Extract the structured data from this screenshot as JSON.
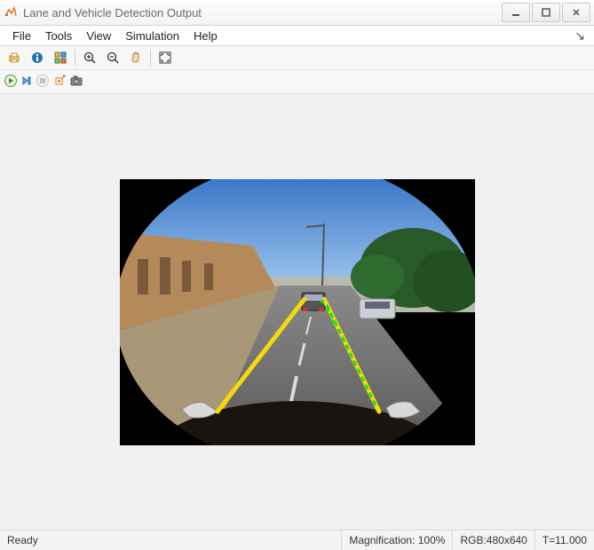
{
  "window": {
    "title": "Lane and Vehicle Detection Output"
  },
  "menus": {
    "file": "File",
    "tools": "Tools",
    "view": "View",
    "simulation": "Simulation",
    "help": "Help"
  },
  "status": {
    "ready": "Ready",
    "magnification": "Magnification: 100%",
    "imageinfo": "RGB:480x640",
    "time": "T=11.000"
  },
  "toolbar_icons": {
    "print": "print-icon",
    "info": "info-icon",
    "pixel_region": "pixel-region-icon",
    "zoom_in": "zoom-in-icon",
    "zoom_out": "zoom-out-icon",
    "pan": "pan-icon",
    "fit": "fit-to-window-icon",
    "run": "run-icon",
    "step": "step-forward-icon",
    "stop": "stop-icon",
    "highlight_block": "highlight-block-icon",
    "snapshot": "snapshot-icon"
  }
}
